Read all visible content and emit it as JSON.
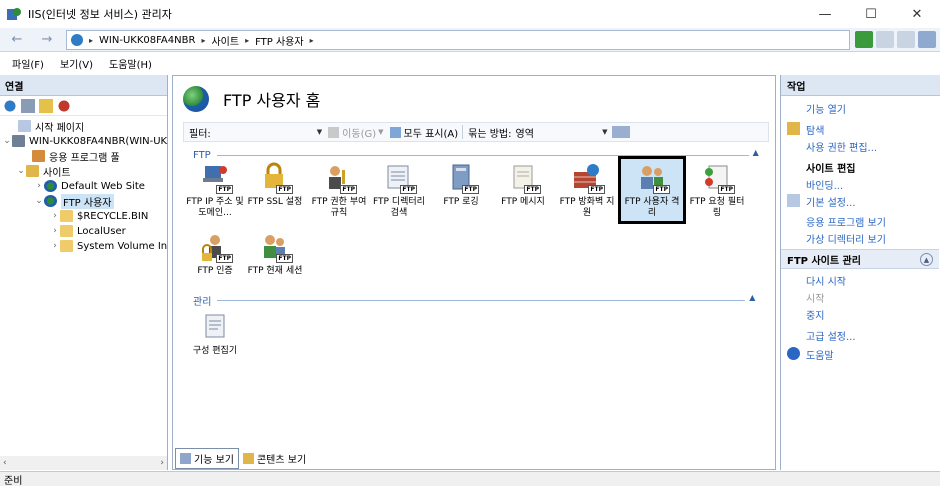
{
  "window": {
    "title": "IIS(인터넷 정보 서비스) 관리자",
    "minimize": "—",
    "maximize": "☐",
    "close": "✕"
  },
  "address": {
    "back": "←",
    "forward": "→",
    "crumbs": [
      "WIN-UKK08FA4NBR",
      "사이트",
      "FTP 사용자"
    ],
    "separator": "▸"
  },
  "menu": [
    "파일(F)",
    "보기(V)",
    "도움말(H)"
  ],
  "connections": {
    "title": "연결",
    "tree": [
      {
        "label": "시작 페이지",
        "exp": "",
        "icon": "start-page-icon"
      },
      {
        "label": "WIN-UKK08FA4NBR(WIN-UK",
        "exp": "⌄",
        "icon": "server-icon"
      },
      {
        "label": "응용 프로그램 풀",
        "exp": "",
        "icon": "app-pool-icon"
      },
      {
        "label": "사이트",
        "exp": "⌄",
        "icon": "sites-folder-icon"
      },
      {
        "label": "Default Web Site",
        "exp": "›",
        "icon": "globe-icon"
      },
      {
        "label": "FTP 사용자",
        "exp": "⌄",
        "icon": "globe-icon"
      },
      {
        "label": "$RECYCLE.BIN",
        "exp": "›",
        "icon": "folder-icon"
      },
      {
        "label": "LocalUser",
        "exp": "›",
        "icon": "folder-icon"
      },
      {
        "label": "System Volume In",
        "exp": "›",
        "icon": "folder-icon"
      }
    ],
    "scroll_left": "‹",
    "scroll_right": "›"
  },
  "main": {
    "title": "FTP 사용자 홈",
    "filter": {
      "label": "필터:",
      "go": "이동(G)",
      "show_all": "모두 표시(A)",
      "group_label": "묶는 방법:",
      "group_value": "영역"
    },
    "groups": [
      {
        "label": "FTP",
        "collapse": "▲"
      },
      {
        "label": "관리",
        "collapse": "▲"
      }
    ],
    "ftp_features": [
      {
        "label": "FTP IP 주소 및 도메인...",
        "icon": "ip-domain-icon"
      },
      {
        "label": "FTP SSL 설정",
        "icon": "ssl-lock-icon"
      },
      {
        "label": "FTP 권한 부여 규칙",
        "icon": "authorization-icon"
      },
      {
        "label": "FTP 디렉터리 검색",
        "icon": "directory-browse-icon"
      },
      {
        "label": "FTP 로깅",
        "icon": "logging-icon"
      },
      {
        "label": "FTP 메시지",
        "icon": "messages-icon"
      },
      {
        "label": "FTP 방화벽 지원",
        "icon": "firewall-icon"
      },
      {
        "label": "FTP 사용자 격리",
        "icon": "user-isolation-icon"
      },
      {
        "label": "FTP 요청 필터링",
        "icon": "request-filtering-icon"
      },
      {
        "label": "FTP 인증",
        "icon": "authentication-icon"
      },
      {
        "label": "FTP 현재 세션",
        "icon": "current-sessions-icon"
      }
    ],
    "mgmt_features": [
      {
        "label": "구성 편집기",
        "icon": "config-editor-icon"
      }
    ],
    "views": {
      "features": "기능 보기",
      "content": "콘텐츠 보기"
    }
  },
  "actions": {
    "title": "작업",
    "open_feature": "기능 열기",
    "explore": "탐색",
    "edit_permissions": "사용 권한 편집...",
    "edit_site_head": "사이트 편집",
    "bindings": "바인딩...",
    "basic_settings": "기본 설정...",
    "view_apps": "응용 프로그램 보기",
    "view_vdirs": "가상 디렉터리 보기",
    "ftp_manage_head": "FTP 사이트 관리",
    "collapse": "▲",
    "restart": "다시 시작",
    "start": "시작",
    "stop": "중지",
    "advanced": "고급 설정...",
    "help": "도움말"
  },
  "status": "준비",
  "colors": {
    "accent_link": "#2a66c4",
    "panel_header": "#dde7f3",
    "selected": "#cde3f6"
  }
}
